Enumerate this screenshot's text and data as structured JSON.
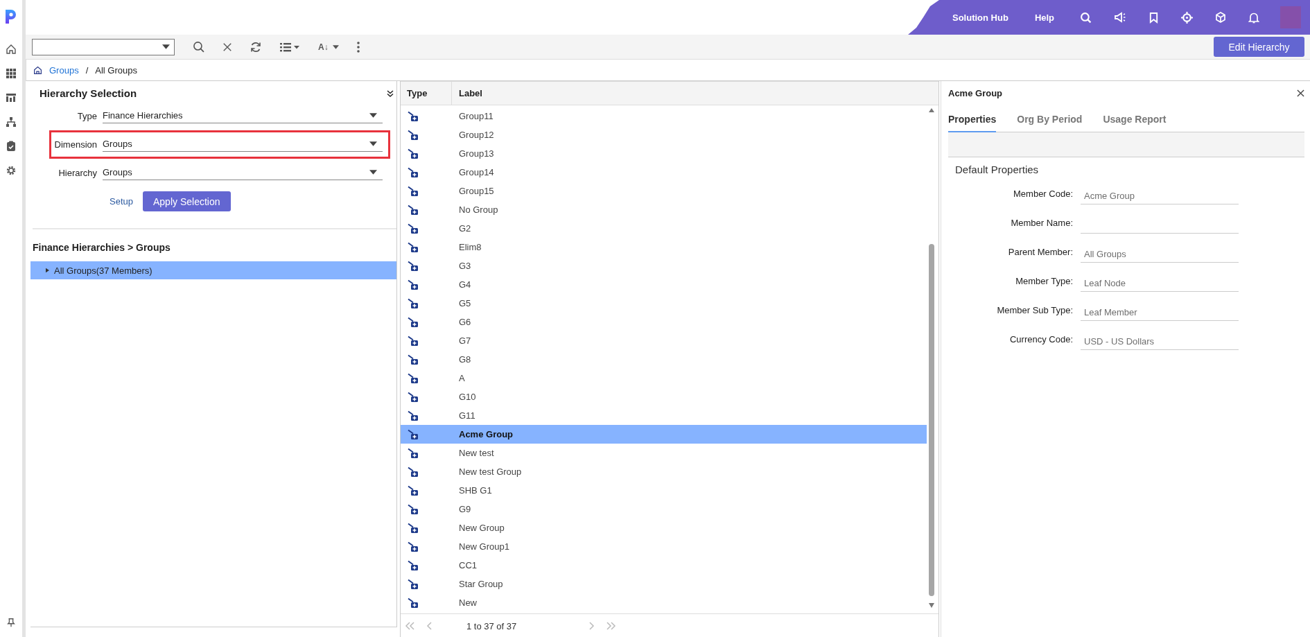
{
  "header": {
    "links": [
      "Solution Hub",
      "Help"
    ]
  },
  "toolbar": {
    "sort_label": "A↓",
    "edit_button": "Edit Hierarchy"
  },
  "breadcrumb": [
    {
      "label": "Groups",
      "kind": "link"
    },
    {
      "label": "/",
      "kind": "separator"
    },
    {
      "label": "All Groups",
      "kind": "current"
    }
  ],
  "hierarchy_selection": {
    "title": "Hierarchy Selection",
    "fields": [
      {
        "label": "Type",
        "value": "Finance Hierarchies",
        "highlighted": false
      },
      {
        "label": "Dimension",
        "value": "Groups",
        "highlighted": true
      },
      {
        "label": "Hierarchy",
        "value": "Groups",
        "highlighted": false
      }
    ],
    "setup_link": "Setup",
    "apply_button": "Apply Selection",
    "path_title": "Finance Hierarchies > Groups",
    "tree": [
      {
        "label": "All Groups(37 Members)",
        "expanded": false,
        "selected": true
      }
    ]
  },
  "table": {
    "columns": [
      "Type",
      "Label"
    ],
    "rows": [
      {
        "label": "Group11",
        "selected": false
      },
      {
        "label": "Group12",
        "selected": false
      },
      {
        "label": "Group13",
        "selected": false
      },
      {
        "label": "Group14",
        "selected": false
      },
      {
        "label": "Group15",
        "selected": false
      },
      {
        "label": "No Group",
        "selected": false
      },
      {
        "label": "G2",
        "selected": false
      },
      {
        "label": "Elim8",
        "selected": false
      },
      {
        "label": "G3",
        "selected": false
      },
      {
        "label": "G4",
        "selected": false
      },
      {
        "label": "G5",
        "selected": false
      },
      {
        "label": "G6",
        "selected": false
      },
      {
        "label": "G7",
        "selected": false
      },
      {
        "label": "G8",
        "selected": false
      },
      {
        "label": "A",
        "selected": false
      },
      {
        "label": "G10",
        "selected": false
      },
      {
        "label": "G11",
        "selected": false
      },
      {
        "label": "Acme Group",
        "selected": true
      },
      {
        "label": "New test",
        "selected": false
      },
      {
        "label": "New test Group",
        "selected": false
      },
      {
        "label": "SHB G1",
        "selected": false
      },
      {
        "label": "G9",
        "selected": false
      },
      {
        "label": "New Group",
        "selected": false
      },
      {
        "label": "New Group1",
        "selected": false
      },
      {
        "label": "CC1",
        "selected": false
      },
      {
        "label": "Star Group",
        "selected": false
      },
      {
        "label": "New",
        "selected": false
      }
    ],
    "pager": "1 to 37 of 37"
  },
  "details": {
    "title": "Acme Group",
    "tabs": [
      {
        "label": "Properties",
        "selected": true
      },
      {
        "label": "Org By Period",
        "selected": false
      },
      {
        "label": "Usage Report",
        "selected": false
      }
    ],
    "section": "Default Properties",
    "fields": [
      {
        "label": "Member Code:",
        "value": "Acme Group"
      },
      {
        "label": "Member Name:"
      },
      {
        "label": "Parent Member:",
        "value": "All Groups"
      },
      {
        "label": "Member Type:",
        "value": "Leaf Node"
      },
      {
        "label": "Member Sub Type:",
        "value": "Leaf Member"
      },
      {
        "label": "Currency Code:",
        "value": "USD - US Dollars"
      }
    ]
  }
}
